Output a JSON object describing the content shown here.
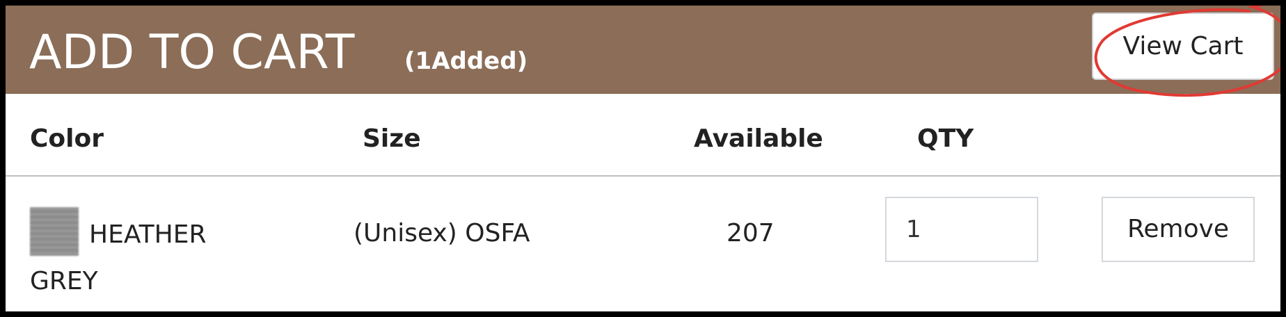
{
  "header": {
    "title": "ADD TO CART",
    "added_count": "(1Added)",
    "view_cart_label": "View Cart",
    "background_color": "#8b6d58",
    "highlight_color": "#e03a33"
  },
  "table": {
    "columns": [
      "Color",
      "Size",
      "Available",
      "QTY"
    ],
    "rows": [
      {
        "color_line1": "HEATHER",
        "color_line2": "GREY",
        "swatch_color": "#8f8f8f",
        "size": "(Unisex) OSFA",
        "available": "207",
        "qty": "1",
        "remove_label": "Remove"
      }
    ]
  }
}
